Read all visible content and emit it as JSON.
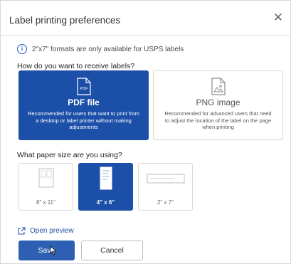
{
  "dialog": {
    "title": "Label printing preferences",
    "close_icon": "close-icon"
  },
  "info": {
    "icon": "info-icon",
    "glyph": "i",
    "text": "2\"x7\" formats are only available for USPS labels"
  },
  "receive": {
    "question": "How do you want to receive labels?",
    "options": [
      {
        "name": "PDF file",
        "icon_text": "PDF",
        "description": "Recommended for users that want to print from a desktop or label printer without making adjustments",
        "selected": true
      },
      {
        "name": "PNG image",
        "icon_text": "",
        "description": "Recommended for advanced users that need to adjust the location of the label on the page when printing",
        "selected": false
      }
    ]
  },
  "paper": {
    "question": "What paper size are you using?",
    "sizes": [
      {
        "label": "8\" x 11\"",
        "selected": false
      },
      {
        "label": "4\" x 6\"",
        "selected": true
      },
      {
        "label": "2\" x 7\"",
        "selected": false
      }
    ]
  },
  "preview": {
    "label": "Open preview",
    "icon": "external-link-icon"
  },
  "buttons": {
    "save_label": "Save",
    "cancel_label": "Cancel"
  },
  "colors": {
    "selected": "#1c4fa8",
    "save": "#2d5fb3",
    "link": "#1f4fa5"
  }
}
